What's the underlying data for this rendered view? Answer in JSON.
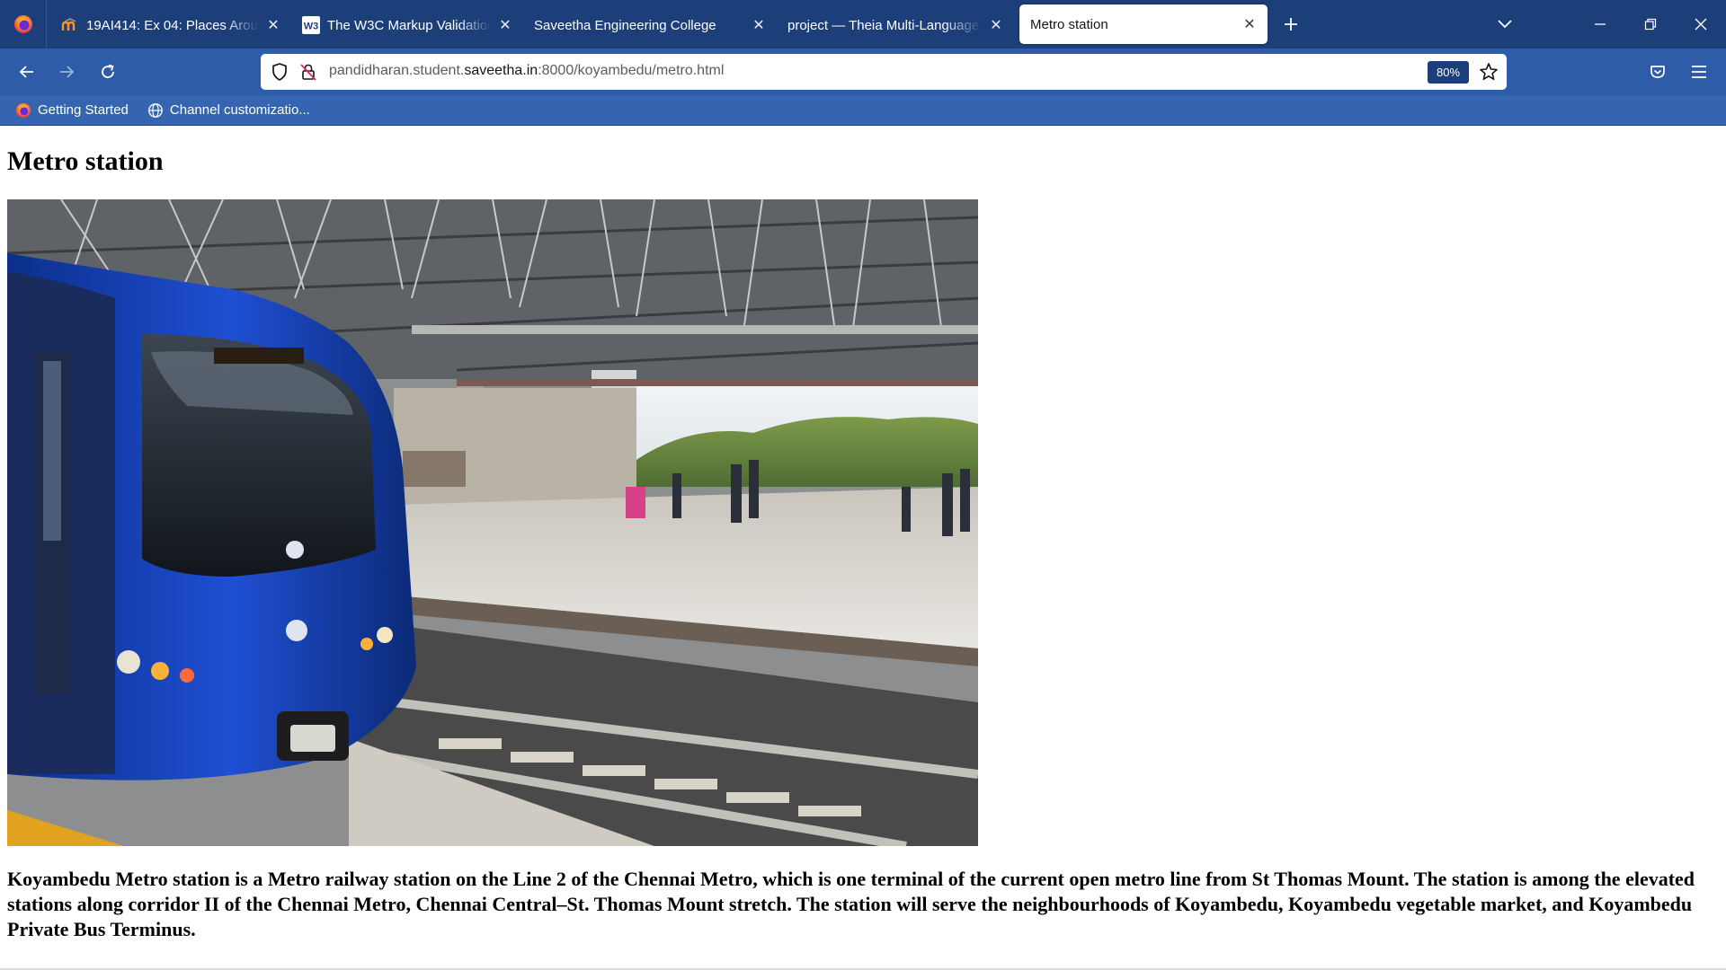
{
  "browser": {
    "tabs": [
      {
        "title": "19AI414: Ex 04: Places Around M",
        "icon": "moodle-icon",
        "active": false
      },
      {
        "title": "The W3C Markup Validation Ser",
        "icon": "w3c-icon",
        "active": false
      },
      {
        "title": "Saveetha Engineering College",
        "icon": "",
        "active": false
      },
      {
        "title": "project — Theia Multi-Language Ex",
        "icon": "",
        "active": false
      },
      {
        "title": "Metro station",
        "icon": "",
        "active": true
      }
    ],
    "url_prefix": "pandidharan.student.",
    "url_host": "saveetha.in",
    "url_suffix": ":8000/koyambedu/metro.html",
    "zoom": "80%",
    "bookmarks": [
      {
        "label": "Getting Started",
        "icon": "firefox-icon"
      },
      {
        "label": "Channel customizatio...",
        "icon": "globe-icon"
      }
    ],
    "colors": {
      "tabstrip": "#1c3f7a",
      "navbar": "#2f5ca8",
      "bookmarks_bar": "#3564b1"
    }
  },
  "page": {
    "heading": "Metro station",
    "image_subject": "Chennai Metro train at Koyambedu station platform",
    "description": "Koyambedu Metro station is a Metro railway station on the Line 2 of the Chennai Metro, which is one terminal of the current open metro line from St Thomas Mount. The station is among the elevated stations along corridor II of the Chennai Metro, Chennai Central–St. Thomas Mount stretch. The station will serve the neighbourhoods of Koyambedu, Koyambedu vegetable market, and Koyambedu Private Bus Terminus."
  }
}
